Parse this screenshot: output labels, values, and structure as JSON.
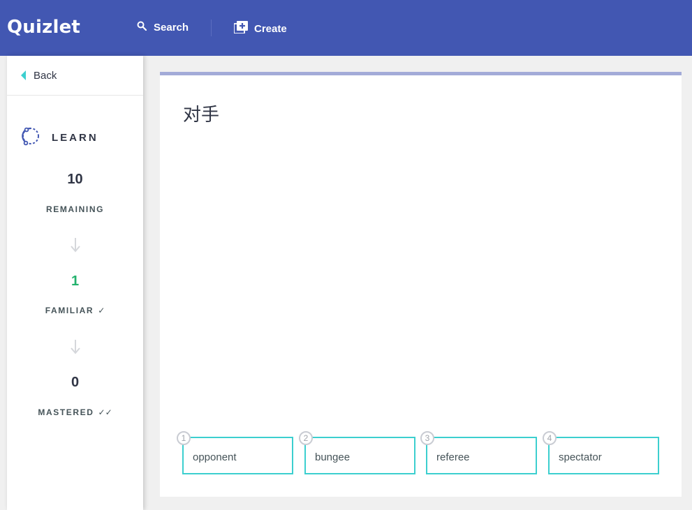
{
  "header": {
    "logo": "Quizlet",
    "search_label": "Search",
    "create_label": "Create",
    "bg_color": "#4257b2"
  },
  "sidebar": {
    "back_label": "Back",
    "mode_label": "LEARN",
    "remaining": {
      "count": "10",
      "label": "REMAINING"
    },
    "familiar": {
      "count": "1",
      "label": "FAMILIAR",
      "icon": "check-icon"
    },
    "mastered": {
      "count": "0",
      "label": "MASTERED",
      "icon": "double-check-icon"
    }
  },
  "question": {
    "term": "对手",
    "progress_fraction": 1.0,
    "choices": [
      {
        "number": "1",
        "text": "opponent"
      },
      {
        "number": "2",
        "text": "bungee"
      },
      {
        "number": "3",
        "text": "referee"
      },
      {
        "number": "4",
        "text": "spectator"
      }
    ]
  },
  "colors": {
    "accent_teal": "#3ccfcf",
    "familiar_green": "#23b26d",
    "progress_track": "#a3abd8"
  }
}
